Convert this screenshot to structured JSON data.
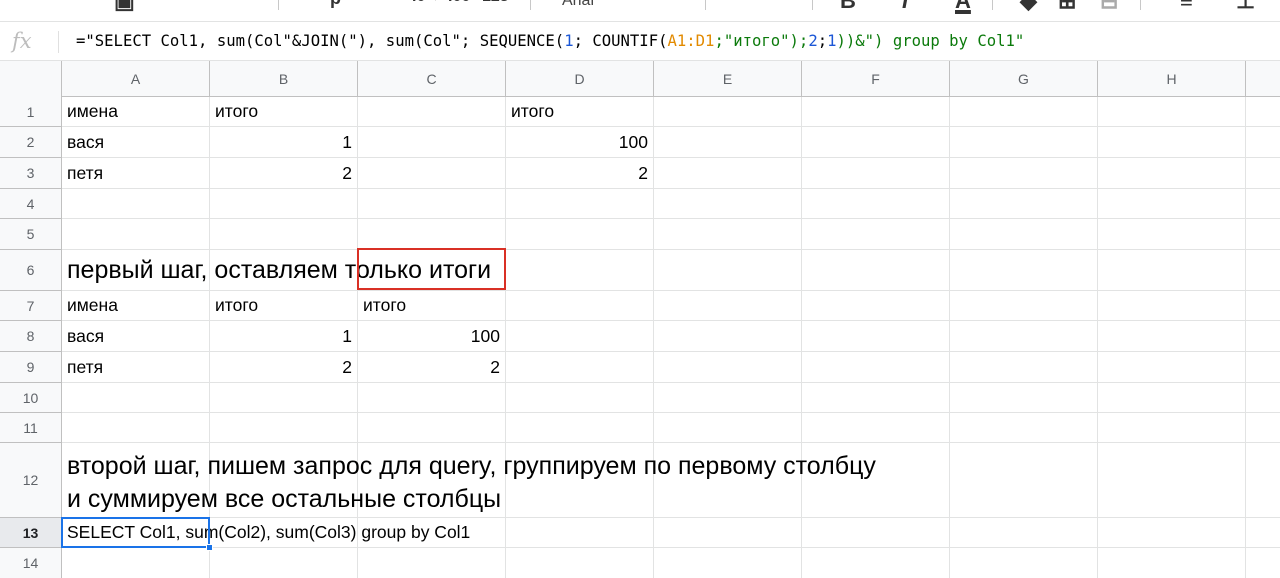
{
  "toolbar": {
    "font_name": "Arial",
    "glyphs": [
      "B",
      "I",
      "A"
    ]
  },
  "formula_bar": {
    "fx_label": "fx",
    "formula_parts": [
      {
        "t": "=\"SELECT Col1, sum(Col\"&JOIN(\"), sum(Col\"; SEQUENCE(",
        "c": "plain"
      },
      {
        "t": "1",
        "c": "num"
      },
      {
        "t": "; COUNTIF(",
        "c": "plain"
      },
      {
        "t": "A1:D1",
        "c": "ref"
      },
      {
        "t": ";\"итого\");",
        "c": "str"
      },
      {
        "t": "2",
        "c": "num"
      },
      {
        "t": ";",
        "c": "plain"
      },
      {
        "t": "1",
        "c": "num"
      },
      {
        "t": "))&\") group by Col1\"",
        "c": "str"
      }
    ]
  },
  "columns": [
    "A",
    "B",
    "C",
    "D",
    "E",
    "F",
    "G",
    "H"
  ],
  "rows": [
    "1",
    "2",
    "3",
    "4",
    "5",
    "6",
    "7",
    "8",
    "9",
    "10",
    "11",
    "12",
    "13",
    "14"
  ],
  "active_row": "13",
  "cells": {
    "A1": "имена",
    "B1": "итого",
    "D1": "итого",
    "A2": "вася",
    "B2": "1",
    "D2": "100",
    "A3": "петя",
    "B3": "2",
    "D3": "2",
    "A6": "первый шаг, оставляем только итоги",
    "A7": "имена",
    "B7": "итого",
    "C7": "итого",
    "A8": "вася",
    "B8": "1",
    "C8": "100",
    "A9": "петя",
    "B9": "2",
    "C9": "2",
    "A12": "второй шаг, пишем запрос для query, группируем по первому столбцу\nи суммируем все остальные столбцы",
    "A13": "SELECT Col1, sum(Col2), sum(Col3) group by Col1"
  },
  "colors": {
    "selection": "#1a73e8",
    "annotation": "#d93025",
    "header_bg": "#f8f9fa"
  },
  "icons": [
    "fx-icon",
    "bold-icon",
    "italic-icon",
    "text-color-icon"
  ]
}
